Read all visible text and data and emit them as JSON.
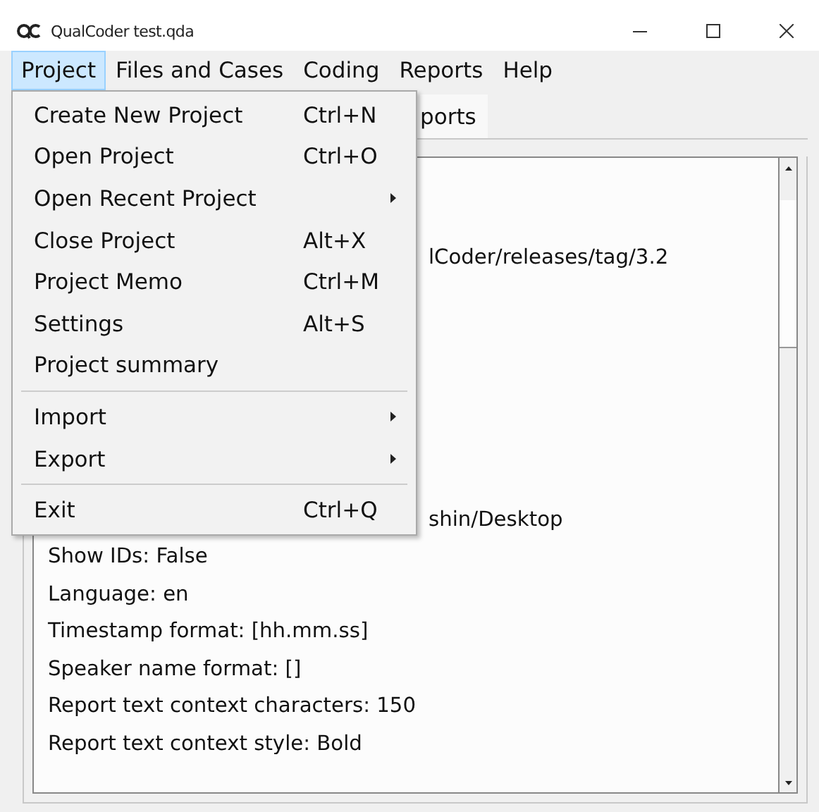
{
  "window": {
    "title": "QualCoder test.qda"
  },
  "menu_bar": [
    {
      "label": "Project",
      "selected": true
    },
    {
      "label": "Files and Cases",
      "selected": false
    },
    {
      "label": "Coding",
      "selected": false
    },
    {
      "label": "Reports",
      "selected": false
    },
    {
      "label": "Help",
      "selected": false
    }
  ],
  "tabs": [
    {
      "label": "ports",
      "selected": true
    }
  ],
  "project_menu": [
    {
      "kind": "action",
      "label": "Create New Project",
      "shortcut": "Ctrl+N"
    },
    {
      "kind": "action",
      "label": "Open Project",
      "shortcut": "Ctrl+O"
    },
    {
      "kind": "submenu",
      "label": "Open Recent Project"
    },
    {
      "kind": "action",
      "label": "Close Project",
      "shortcut": "Alt+X"
    },
    {
      "kind": "action",
      "label": "Project Memo",
      "shortcut": "Ctrl+M"
    },
    {
      "kind": "action",
      "label": "Settings",
      "shortcut": "Alt+S"
    },
    {
      "kind": "action",
      "label": "Project summary"
    },
    {
      "kind": "separator"
    },
    {
      "kind": "submenu",
      "label": "Import"
    },
    {
      "kind": "submenu",
      "label": "Export"
    },
    {
      "kind": "separator"
    },
    {
      "kind": "action",
      "label": "Exit",
      "shortcut": "Ctrl+Q"
    }
  ],
  "text_area": {
    "lines_behind_menu": [
      "lCoder/releases/tag/3.2",
      "shin/Desktop"
    ],
    "lines": [
      "Show IDs: False",
      "Language: en",
      "Timestamp format: [hh.mm.ss]",
      "Speaker name format: []",
      "Report text context characters: 150",
      "Report text context style: Bold"
    ]
  }
}
